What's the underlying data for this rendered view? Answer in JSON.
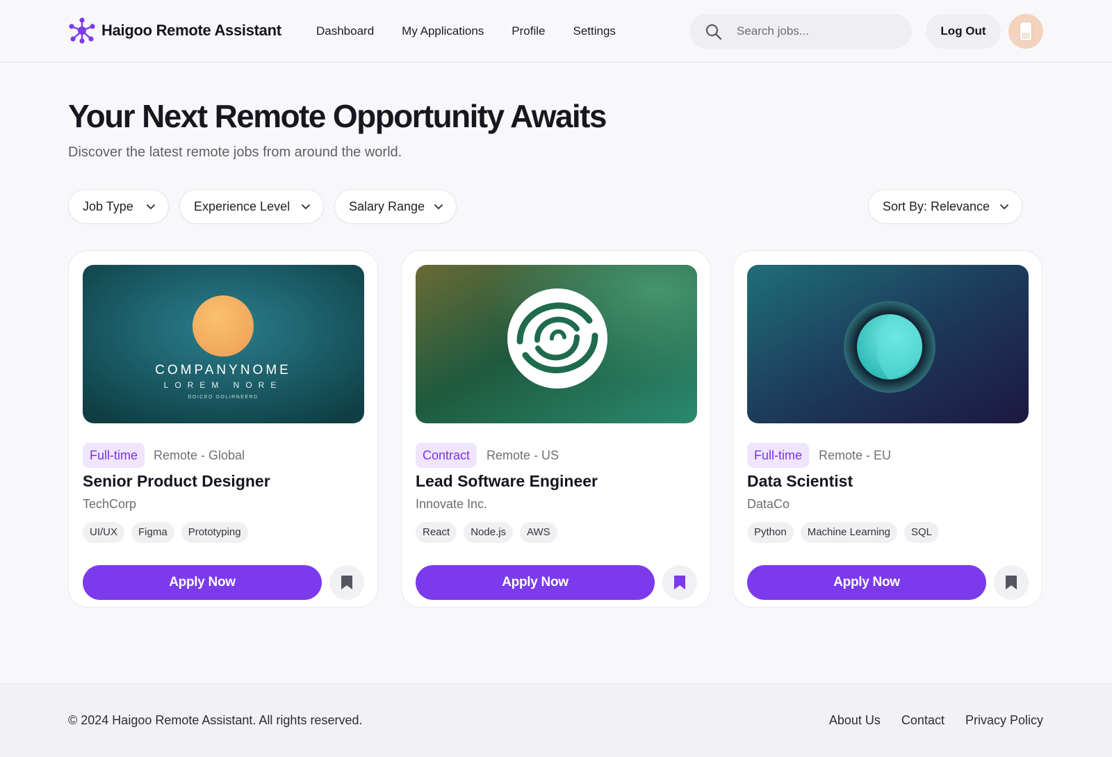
{
  "brand": {
    "name": "Haigoo Remote Assistant",
    "accent": "#7c3aed"
  },
  "nav": {
    "items": [
      "Dashboard",
      "My Applications",
      "Profile",
      "Settings"
    ]
  },
  "search": {
    "placeholder": "Search jobs...",
    "value": ""
  },
  "header": {
    "logout_label": "Log Out"
  },
  "hero": {
    "title": "Your Next Remote Opportunity Awaits",
    "subtitle": "Discover the latest remote jobs from around the world."
  },
  "filters": {
    "job_type": "Job Type",
    "experience": "Experience Level",
    "salary": "Salary Range",
    "sort": "Sort By: Relevance"
  },
  "jobs": [
    {
      "type": "Full-time",
      "location": "Remote - Global",
      "title": "Senior Product Designer",
      "company": "TechCorp",
      "tags": [
        "UI/UX",
        "Figma",
        "Prototyping"
      ],
      "apply_label": "Apply Now",
      "bookmarked": false,
      "logo": {
        "line1": "COMPANYNOME",
        "line2": "LOREM NORE",
        "line3": "DOICEO OOLIRNEERD"
      }
    },
    {
      "type": "Contract",
      "location": "Remote - US",
      "title": "Lead Software Engineer",
      "company": "Innovate Inc.",
      "tags": [
        "React",
        "Node.js",
        "AWS"
      ],
      "apply_label": "Apply Now",
      "bookmarked": true
    },
    {
      "type": "Full-time",
      "location": "Remote - EU",
      "title": "Data Scientist",
      "company": "DataCo",
      "tags": [
        "Python",
        "Machine Learning",
        "SQL"
      ],
      "apply_label": "Apply Now",
      "bookmarked": false
    }
  ],
  "footer": {
    "copyright": "© 2024 Haigoo Remote Assistant. All rights reserved.",
    "links": [
      "About Us",
      "Contact",
      "Privacy Policy"
    ]
  }
}
